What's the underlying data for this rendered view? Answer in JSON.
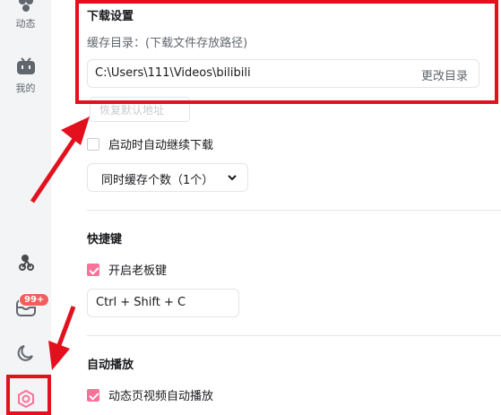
{
  "sidebar": {
    "dynamic_label": "动态",
    "mine_label": "我的",
    "badge_count": "99+"
  },
  "download": {
    "title": "下载设置",
    "cache_dir_label": "缓存目录：(下载文件存放路径)",
    "path_value": "C:\\Users\\111\\Videos\\bilibili",
    "change_dir": "更改目录",
    "restore_default": "恢复默认地址",
    "auto_resume_label": "启动时自动继续下载",
    "auto_resume_checked": false,
    "concurrent_select": "同时缓存个数（1个）"
  },
  "shortcut": {
    "title": "快捷键",
    "boss_key_label": "开启老板键",
    "boss_key_checked": true,
    "boss_key_value": "Ctrl + Shift + C"
  },
  "autoplay": {
    "title": "自动播放",
    "feed_autoplay_label": "动态页视频自动播放",
    "feed_autoplay_checked": true
  },
  "colors": {
    "accent": "#fb7299",
    "annotation": "#e3101d",
    "badge": "#f25d5d"
  }
}
